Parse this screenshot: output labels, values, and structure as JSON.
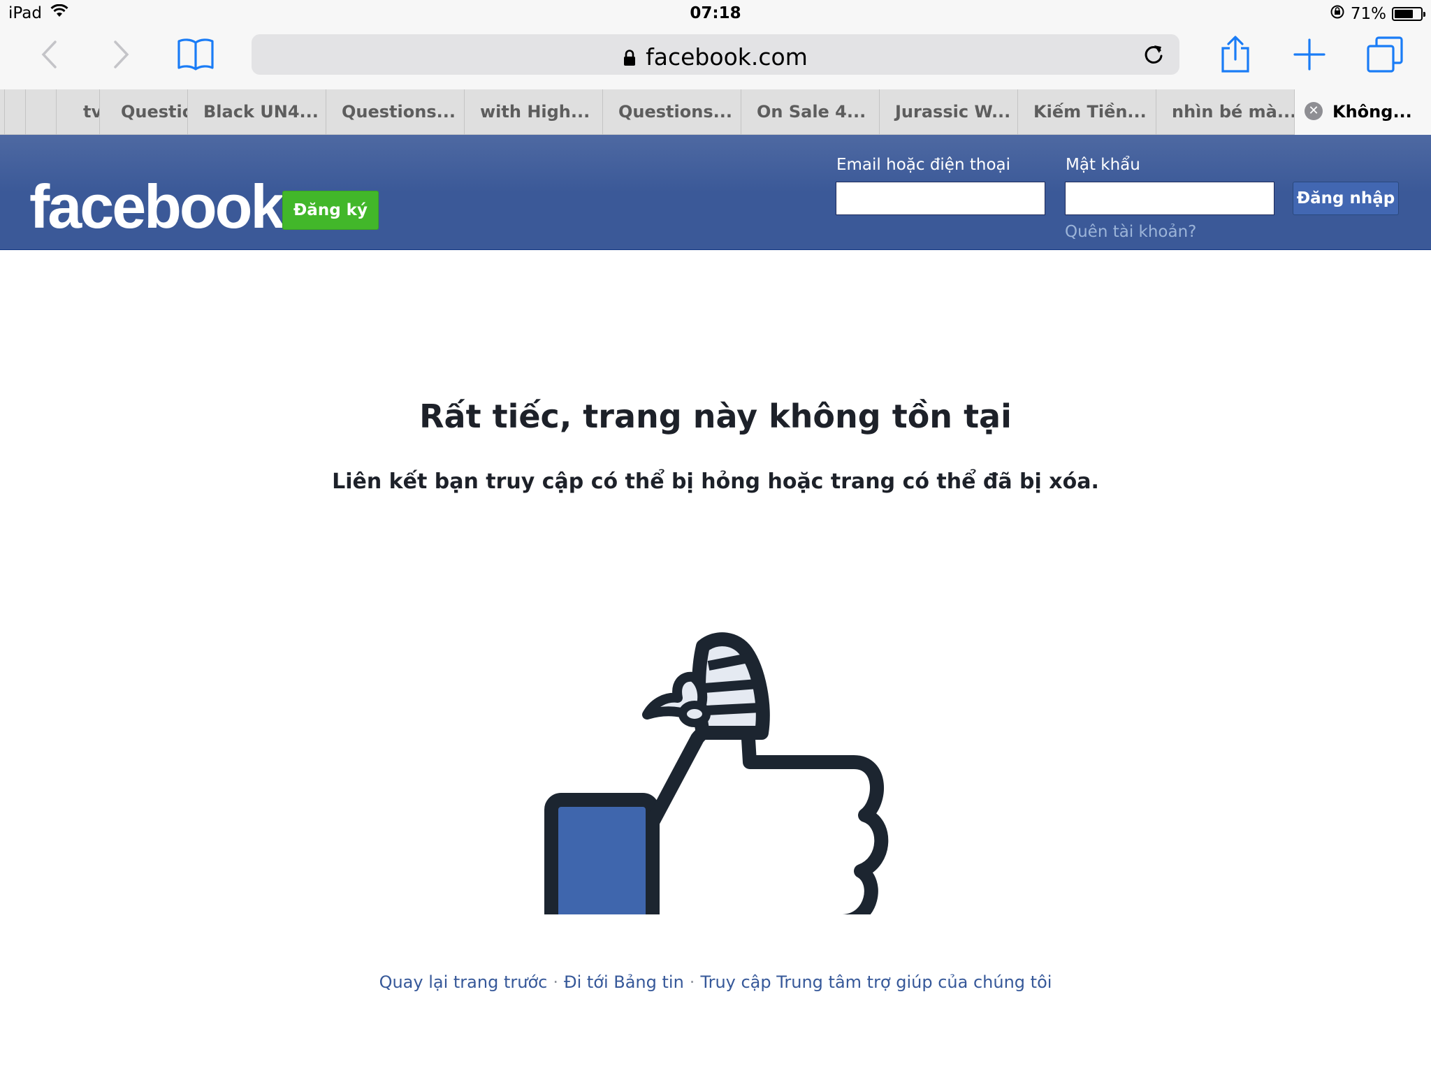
{
  "status_bar": {
    "device": "iPad",
    "time": "07:18",
    "battery": "71%",
    "battery_level": 0.71
  },
  "toolbar": {
    "url": "facebook.com"
  },
  "tabs": [
    {
      "label": ""
    },
    {
      "label": ""
    },
    {
      "label": "tv"
    },
    {
      "label": "Questio"
    },
    {
      "label": "Black UN4..."
    },
    {
      "label": "Questions..."
    },
    {
      "label": "with High..."
    },
    {
      "label": "Questions..."
    },
    {
      "label": "On Sale 4..."
    },
    {
      "label": "Jurassic W..."
    },
    {
      "label": "Kiếm Tiền..."
    },
    {
      "label": "nhìn bé mà..."
    },
    {
      "label": "Không..."
    }
  ],
  "fb": {
    "logo": "facebook",
    "signup": "Đăng ký",
    "email_label": "Email hoặc điện thoại",
    "password_label": "Mật khẩu",
    "login": "Đăng nhập",
    "forgot": "Quên tài khoản?"
  },
  "error": {
    "title": "Rất tiếc, trang này không tồn tại",
    "subtitle": "Liên kết bạn truy cập có thể bị hỏng hoặc trang có thể đã bị xóa."
  },
  "footer": {
    "back": "Quay lại trang trước",
    "feed": "Đi tới Bảng tin",
    "help": "Truy cập Trung tâm trợ giúp của chúng tôi",
    "separator": "·"
  },
  "colors": {
    "fb_blue": "#3b5998",
    "signup_green": "#42b72a",
    "ios_blue": "#1a7cf6"
  }
}
